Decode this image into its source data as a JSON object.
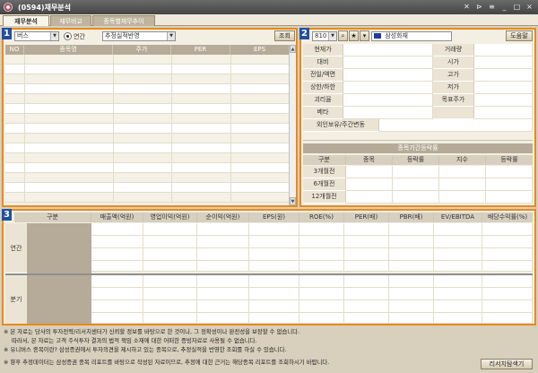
{
  "window": {
    "title": "(0594)재무분석"
  },
  "tabs": [
    {
      "label": "재무분석",
      "active": true
    },
    {
      "label": "재무비교",
      "active": false
    },
    {
      "label": "종목별재무추이",
      "active": false
    }
  ],
  "panel1": {
    "number": "1",
    "category_select": "버스",
    "radio_label": "연간",
    "basis_select": "추정실적반영",
    "query_button": "조회",
    "columns": [
      "NO",
      "종목명",
      "주가",
      "PER",
      "EPS"
    ]
  },
  "panel2": {
    "number": "2",
    "code": "810",
    "stock_name": "삼성화재",
    "help_button": "도움말",
    "left_labels": [
      "현재가",
      "대비",
      "전일/액면",
      "상한/하한",
      "괴리율",
      "베타",
      "외인보유/주간변동"
    ],
    "right_labels": [
      "거래량",
      "시가",
      "고가",
      "저가",
      "목표주가"
    ],
    "period_title": "종목기간등락률",
    "period_headers": [
      "구분",
      "종목",
      "등락률",
      "지수",
      "등락률"
    ],
    "period_rows": [
      "3개월전",
      "6개월전",
      "12개월전"
    ]
  },
  "panel3": {
    "number": "3",
    "headers": [
      "구분",
      "매출액(억원)",
      "영업이익(억원)",
      "순이익(억원)",
      "EPS(원)",
      "ROE(%)",
      "PER(배)",
      "PBR(배)",
      "EV/EBITDA",
      "배당수익률(%)"
    ],
    "row_groups": [
      "연간",
      "분기"
    ]
  },
  "notes": [
    "※ 본 자료는 당사의 투자전략/리서치센터가 신뢰할 정보를 바탕으로 한 것이나, 그 정확성이나 완전성을 보장할 수 없습니다.",
    "따라서, 본 자료는 고객 주식투자 결과의 법적 책임 소재에 대한 어떠한 증빙자료로 사용될 수 없습니다.",
    "※ 유니버스 종목이란?   삼성증권에서 투자의견을 제시하고 있는 종목으로, 추정실적을 반영한 조회를 하실 수 있습니다.",
    "※ 향후 추정데이터는 삼성증권 종목 리포트를 바탕으로 작성된 자료이므로, 추정에 대한 근거는 해당종목 리포트를 조회하시기 바랍니다."
  ],
  "report_button": "리서치탐색기"
}
